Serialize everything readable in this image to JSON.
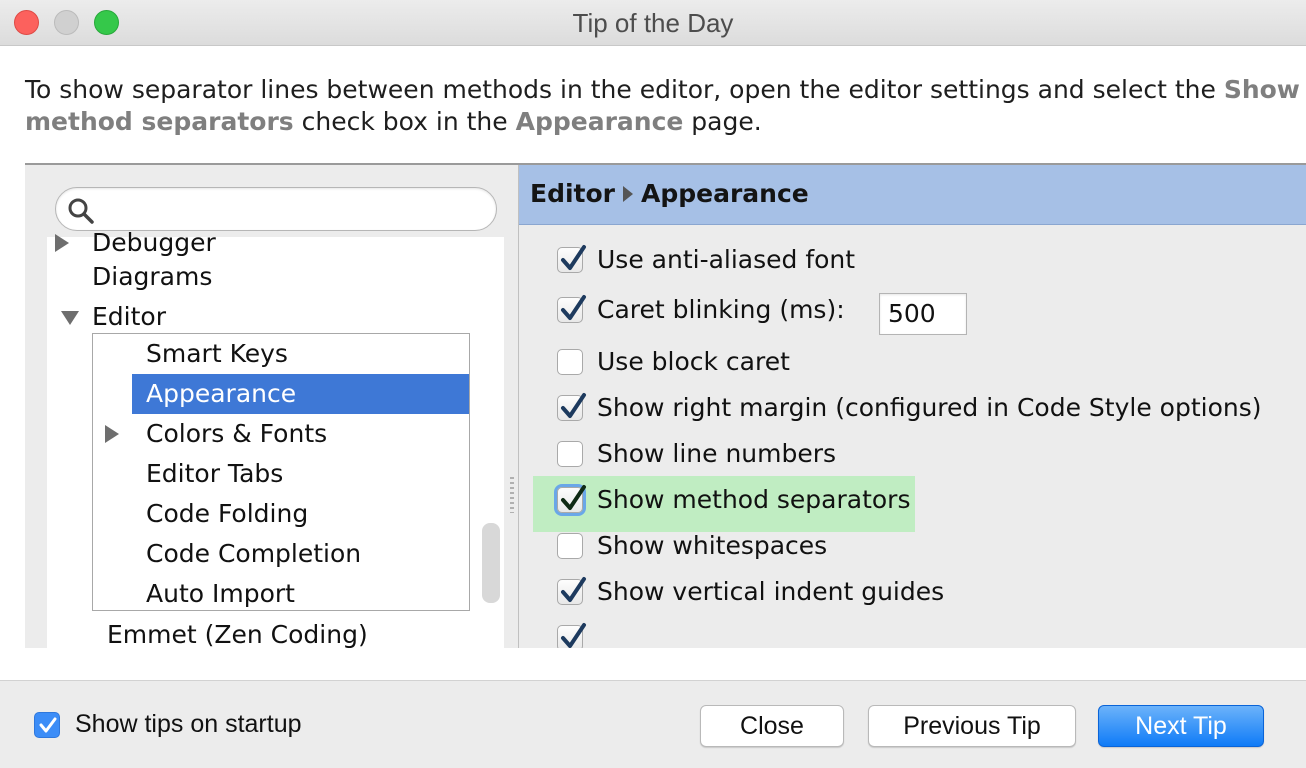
{
  "window": {
    "title": "Tip of the Day",
    "traffic_lights": [
      "close",
      "minimize",
      "zoom"
    ]
  },
  "tip": {
    "text_before": "To show separator lines between methods in the editor, open the editor settings and select the ",
    "highlight1": "Show method separators",
    "text_middle": " check box in the ",
    "highlight2": "Appearance",
    "text_after": " page."
  },
  "settings": {
    "search": {
      "placeholder": "",
      "value": ""
    },
    "tree": {
      "debugger_label": "Debugger",
      "diagrams_label": "Diagrams",
      "editor_label": "Editor",
      "children": [
        "Smart Keys",
        "Appearance",
        "Colors & Fonts",
        "Editor Tabs",
        "Code Folding",
        "Code Completion",
        "Auto Import"
      ],
      "selected_child": "Appearance",
      "emmet_label": "Emmet (Zen Coding)"
    },
    "breadcrumb": {
      "parent": "Editor",
      "current": "Appearance"
    },
    "options": [
      {
        "label": "Use anti-aliased font",
        "checked": true
      },
      {
        "label": "Caret blinking (ms):",
        "checked": true
      },
      {
        "label": "Use block caret",
        "checked": false
      },
      {
        "label": "Show right margin (configured in Code Style options)",
        "checked": true
      },
      {
        "label": "Show line numbers",
        "checked": false
      },
      {
        "label": "Show method separators",
        "checked": true,
        "highlighted": true
      },
      {
        "label": "Show whitespaces",
        "checked": false
      },
      {
        "label": "Show vertical indent guides",
        "checked": true
      },
      {
        "label": "",
        "checked": true
      }
    ],
    "caret_blink_value": "500",
    "highlight_color": "#c0edc2"
  },
  "footer": {
    "show_tips_label": "Show tips on startup",
    "show_tips_checked": true,
    "close_label": "Close",
    "previous_label": "Previous Tip",
    "next_label": "Next Tip",
    "accent_color": "#1b7ef7"
  }
}
